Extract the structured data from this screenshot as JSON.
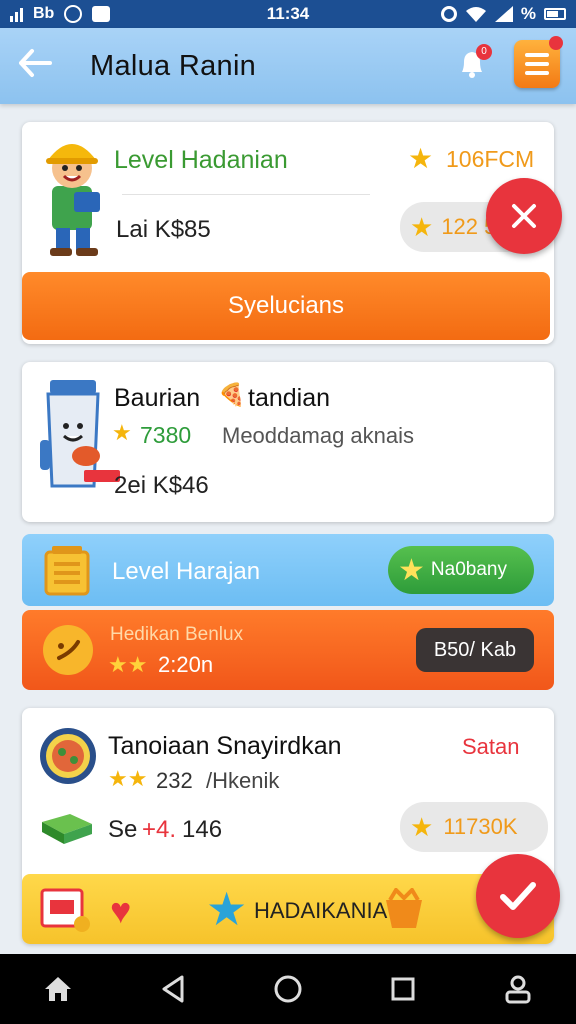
{
  "status_bar": {
    "time": "11:34",
    "left_glyphs": [
      "signal-icon",
      "sim-icon",
      "sync-icon",
      "notification-icon"
    ],
    "battery_label": "%"
  },
  "header": {
    "title": "Malua Ranin",
    "back_icon": "back-arrow-icon",
    "notification_icon": "bell-icon",
    "notification_count": "0",
    "menu_icon": "menu-icon"
  },
  "card1": {
    "title": "Level Hadanian",
    "score": "106FCM",
    "subtitle": "Lai K$85",
    "price": "122 502",
    "action": "Syelucians",
    "fab": "close-icon"
  },
  "card2": {
    "title": "Baurian",
    "title_emoji": "🍕",
    "title_suffix": "tandian",
    "rating": "7380",
    "rating_text": "Meoddamag aknais",
    "subtitle": "2ei K$46"
  },
  "strip_level": {
    "label": "Level Harajan",
    "action": "Na0bany"
  },
  "strip_bonus": {
    "title": "Hedikan Benlux",
    "stars": "★★",
    "value": "2:20n",
    "action": "B50/ Kab"
  },
  "card3": {
    "title": "Tanoiaan  Snayirdkan",
    "status": "Satan",
    "stars": "★★",
    "rating": "232",
    "rating_text": "/Hkenik",
    "subtitle_prefix": "Se",
    "subtitle_mark": "+4.",
    "subtitle_num": "146",
    "price": "11730K",
    "fab": "check-icon"
  },
  "strip_footer": {
    "label": "HADAIKANIA"
  },
  "colors": {
    "status_bar": "#1c4f93",
    "app_bar": "#a9d3f7",
    "orange": "#f36b12",
    "red": "#e8343d",
    "green": "#2e9c3a",
    "yellow": "#f6c32b",
    "blue_strip": "#6cbdf3"
  }
}
